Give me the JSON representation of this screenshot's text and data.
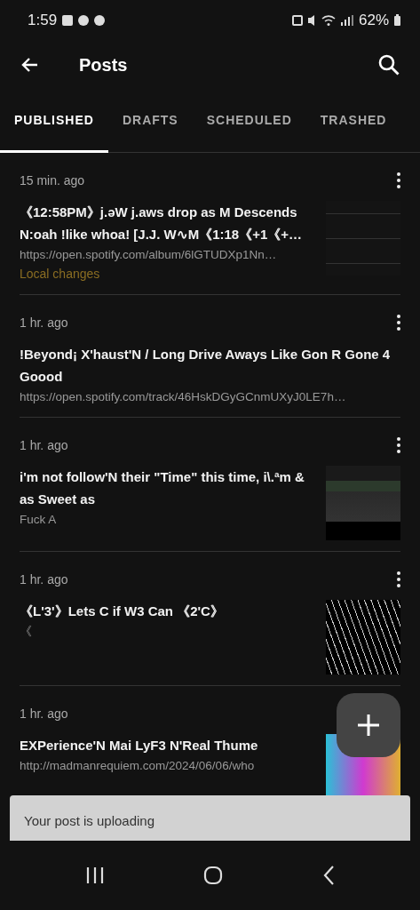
{
  "status_bar": {
    "time": "1:59",
    "battery": "62%"
  },
  "app_bar": {
    "title": "Posts"
  },
  "tabs": [
    {
      "label": "PUBLISHED",
      "selected": true
    },
    {
      "label": "DRAFTS",
      "selected": false
    },
    {
      "label": "SCHEDULED",
      "selected": false
    },
    {
      "label": "TRASHED",
      "selected": false
    }
  ],
  "posts": [
    {
      "time": "15 min. ago",
      "title": "《12:58PM》j.əW j.aws drop as M Descends N:oah !like whoa! [J.J. W∿M《1:18《+1《+…",
      "excerpt": "https://open.spotify.com/album/6lGTUDXp1Nn…",
      "note": "Local changes",
      "menu_visible": true,
      "thumbnail": {
        "kind": "text"
      }
    },
    {
      "time": "1 hr. ago",
      "title": "!Beyond¡ X'haust'N / Long Drive Aways Like Gon R Gone 4 Goood",
      "excerpt": "https://open.spotify.com/track/46HskDGyGCnmUXyJ0LE7h…",
      "menu_visible": true
    },
    {
      "time": "1 hr. ago",
      "title": "i'm not follow'N their \"Time\" this time, i\\.ªm & as Sweet as",
      "excerpt": "Fuck A",
      "menu_visible": true,
      "thumbnail": {
        "kind": "screenshot"
      }
    },
    {
      "time": "1 hr. ago",
      "title": "《L'3'》Lets C if W3 Can 《2'C》",
      "excerpt": "《",
      "menu_visible": true,
      "thumbnail": {
        "kind": "pattern"
      }
    },
    {
      "time": "1 hr. ago",
      "title": "EXPerience'N Mai LyF3 N'Real Thume",
      "excerpt": "http://madmanrequiem.com/2024/06/06/who",
      "menu_visible": false,
      "thumbnail": {
        "kind": "colorful"
      }
    }
  ],
  "snackbar": {
    "message": "Your post is uploading"
  }
}
